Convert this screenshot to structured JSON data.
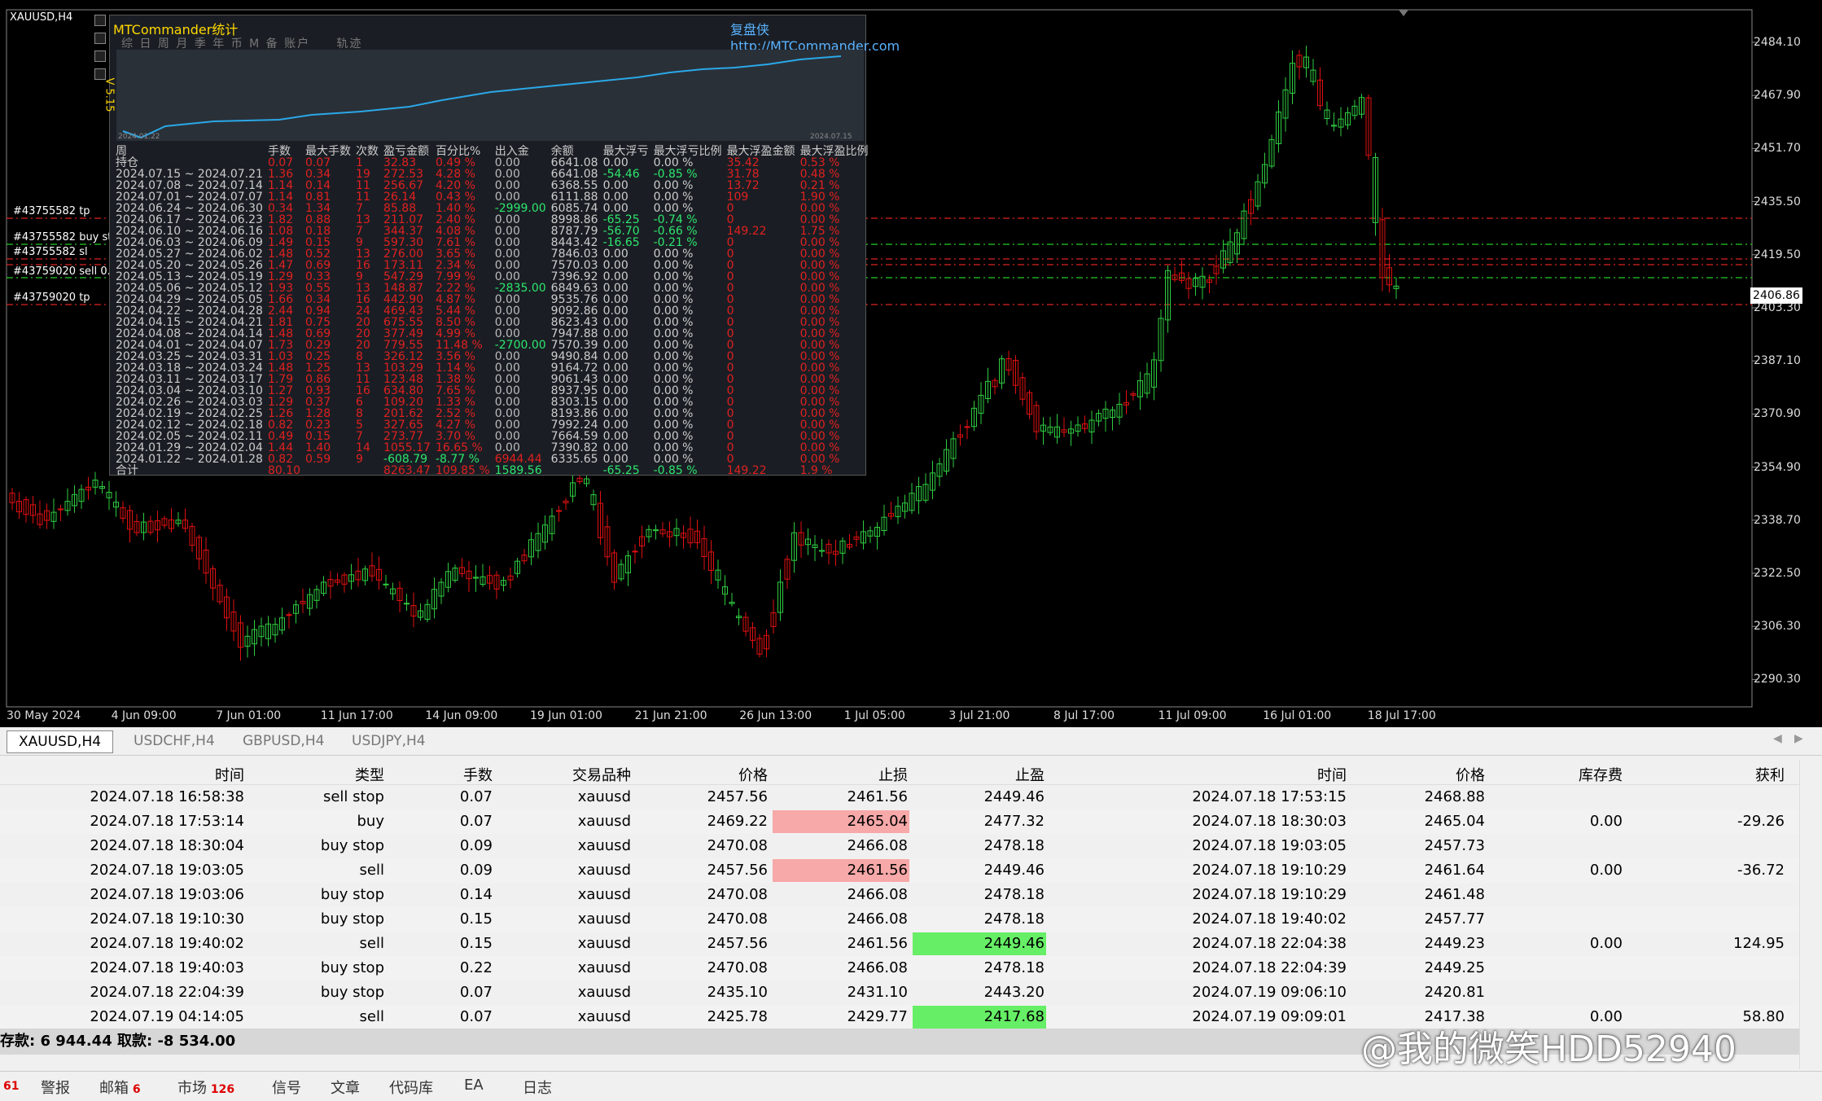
{
  "chart": {
    "symbol_title": "XAUUSD,H4",
    "current_price": "2406.86",
    "price_labels": [
      "2484.10",
      "2467.90",
      "2451.70",
      "2435.50",
      "2419.50",
      "2403.30",
      "2387.10",
      "2370.90",
      "2354.90",
      "2338.70",
      "2322.50",
      "2306.30",
      "2290.30"
    ],
    "time_labels": [
      "30 May 2024",
      "4 Jun 09:00",
      "7 Jun 01:00",
      "11 Jun 17:00",
      "14 Jun 09:00",
      "19 Jun 01:00",
      "21 Jun 21:00",
      "26 Jun 13:00",
      "1 Jul 05:00",
      "3 Jul 21:00",
      "8 Jul 17:00",
      "11 Jul 09:00",
      "16 Jul 01:00",
      "18 Jul 17:00"
    ],
    "order_labels": [
      "#43755582 tp",
      "#43755582 buy st",
      "#43755582 sl",
      "#43759020 sell 0.0",
      "#43759020 tp"
    ]
  },
  "stats": {
    "title": "MTCommander统计",
    "url": "复盘侠 http://MTCommander.com",
    "tabs": "综 日 周 月 季 年 币 M 备 账户",
    "tab_extra": "轨迹",
    "version": "V 5.15",
    "mini_start": "2024.01.22",
    "mini_end": "2024.07.15",
    "headers": [
      "周",
      "手数",
      "最大手数",
      "次数",
      "盈亏金额",
      "百分比%",
      "出入金",
      "余额",
      "最大浮亏",
      "最大浮亏比例",
      "最大浮盈金额",
      "最大浮盈比例"
    ],
    "holding": [
      "持仓",
      "0.07",
      "0.07",
      "1",
      "32.83",
      "0.49 %",
      "0.00",
      "6641.08",
      "0.00",
      "0.00 %",
      "35.42",
      "0.53 %"
    ],
    "rows": [
      [
        "2024.07.15 ~ 2024.07.21",
        "1.36",
        "0.34",
        "19",
        "272.53",
        "4.28 %",
        "0.00",
        "6641.08",
        "-54.46",
        "-0.85 %",
        "31.78",
        "0.48 %"
      ],
      [
        "2024.07.08 ~ 2024.07.14",
        "1.14",
        "0.14",
        "11",
        "256.67",
        "4.20 %",
        "0.00",
        "6368.55",
        "0.00",
        "0.00 %",
        "13.72",
        "0.21 %"
      ],
      [
        "2024.07.01 ~ 2024.07.07",
        "1.14",
        "0.81",
        "11",
        "26.14",
        "0.43 %",
        "0.00",
        "6111.88",
        "0.00",
        "0.00 %",
        "109",
        "1.90 %"
      ],
      [
        "2024.06.24 ~ 2024.06.30",
        "0.34",
        "1.34",
        "7",
        "85.88",
        "1.40 %",
        "-2999.00",
        "6085.74",
        "0.00",
        "0.00 %",
        "0",
        "0.00 %"
      ],
      [
        "2024.06.17 ~ 2024.06.23",
        "1.82",
        "0.88",
        "13",
        "211.07",
        "2.40 %",
        "0.00",
        "8998.86",
        "-65.25",
        "-0.74 %",
        "0",
        "0.00 %"
      ],
      [
        "2024.06.10 ~ 2024.06.16",
        "1.08",
        "0.18",
        "7",
        "344.37",
        "4.08 %",
        "0.00",
        "8787.79",
        "-56.70",
        "-0.66 %",
        "149.22",
        "1.75 %"
      ],
      [
        "2024.06.03 ~ 2024.06.09",
        "1.49",
        "0.15",
        "9",
        "597.30",
        "7.61 %",
        "0.00",
        "8443.42",
        "-16.65",
        "-0.21 %",
        "0",
        "0.00 %"
      ],
      [
        "2024.05.27 ~ 2024.06.02",
        "1.48",
        "0.52",
        "13",
        "276.00",
        "3.65 %",
        "0.00",
        "7846.03",
        "0.00",
        "0.00 %",
        "0",
        "0.00 %"
      ],
      [
        "2024.05.20 ~ 2024.05.26",
        "1.47",
        "0.69",
        "16",
        "173.11",
        "2.34 %",
        "0.00",
        "7570.03",
        "0.00",
        "0.00 %",
        "0",
        "0.00 %"
      ],
      [
        "2024.05.13 ~ 2024.05.19",
        "1.29",
        "0.33",
        "9",
        "547.29",
        "7.99 %",
        "0.00",
        "7396.92",
        "0.00",
        "0.00 %",
        "0",
        "0.00 %"
      ],
      [
        "2024.05.06 ~ 2024.05.12",
        "1.93",
        "0.55",
        "13",
        "148.87",
        "2.22 %",
        "-2835.00",
        "6849.63",
        "0.00",
        "0.00 %",
        "0",
        "0.00 %"
      ],
      [
        "2024.04.29 ~ 2024.05.05",
        "1.66",
        "0.34",
        "16",
        "442.90",
        "4.87 %",
        "0.00",
        "9535.76",
        "0.00",
        "0.00 %",
        "0",
        "0.00 %"
      ],
      [
        "2024.04.22 ~ 2024.04.28",
        "2.44",
        "0.94",
        "24",
        "469.43",
        "5.44 %",
        "0.00",
        "9092.86",
        "0.00",
        "0.00 %",
        "0",
        "0.00 %"
      ],
      [
        "2024.04.15 ~ 2024.04.21",
        "1.81",
        "0.75",
        "20",
        "675.55",
        "8.50 %",
        "0.00",
        "8623.43",
        "0.00",
        "0.00 %",
        "0",
        "0.00 %"
      ],
      [
        "2024.04.08 ~ 2024.04.14",
        "1.48",
        "0.69",
        "20",
        "377.49",
        "4.99 %",
        "0.00",
        "7947.88",
        "0.00",
        "0.00 %",
        "0",
        "0.00 %"
      ],
      [
        "2024.04.01 ~ 2024.04.07",
        "1.73",
        "0.29",
        "20",
        "779.55",
        "11.48 %",
        "-2700.00",
        "7570.39",
        "0.00",
        "0.00 %",
        "0",
        "0.00 %"
      ],
      [
        "2024.03.25 ~ 2024.03.31",
        "1.03",
        "0.25",
        "8",
        "326.12",
        "3.56 %",
        "0.00",
        "9490.84",
        "0.00",
        "0.00 %",
        "0",
        "0.00 %"
      ],
      [
        "2024.03.18 ~ 2024.03.24",
        "1.48",
        "1.25",
        "13",
        "103.29",
        "1.14 %",
        "0.00",
        "9164.72",
        "0.00",
        "0.00 %",
        "0",
        "0.00 %"
      ],
      [
        "2024.03.11 ~ 2024.03.17",
        "1.79",
        "0.86",
        "11",
        "123.48",
        "1.38 %",
        "0.00",
        "9061.43",
        "0.00",
        "0.00 %",
        "0",
        "0.00 %"
      ],
      [
        "2024.03.04 ~ 2024.03.10",
        "1.27",
        "0.93",
        "16",
        "634.80",
        "7.65 %",
        "0.00",
        "8937.95",
        "0.00",
        "0.00 %",
        "0",
        "0.00 %"
      ],
      [
        "2024.02.26 ~ 2024.03.03",
        "1.29",
        "0.37",
        "6",
        "109.20",
        "1.33 %",
        "0.00",
        "8303.15",
        "0.00",
        "0.00 %",
        "0",
        "0.00 %"
      ],
      [
        "2024.02.19 ~ 2024.02.25",
        "1.26",
        "1.28",
        "8",
        "201.62",
        "2.52 %",
        "0.00",
        "8193.86",
        "0.00",
        "0.00 %",
        "0",
        "0.00 %"
      ],
      [
        "2024.02.12 ~ 2024.02.18",
        "0.82",
        "0.23",
        "5",
        "327.65",
        "4.27 %",
        "0.00",
        "7992.24",
        "0.00",
        "0.00 %",
        "0",
        "0.00 %"
      ],
      [
        "2024.02.05 ~ 2024.02.11",
        "0.49",
        "0.15",
        "7",
        "273.77",
        "3.70 %",
        "0.00",
        "7664.59",
        "0.00",
        "0.00 %",
        "0",
        "0.00 %"
      ],
      [
        "2024.01.29 ~ 2024.02.04",
        "1.44",
        "1.40",
        "14",
        "1055.17",
        "16.65 %",
        "0.00",
        "7390.82",
        "0.00",
        "0.00 %",
        "0",
        "0.00 %"
      ],
      [
        "2024.01.22 ~ 2024.01.28",
        "0.82",
        "0.59",
        "9",
        "-608.79",
        "-8.77 %",
        "6944.44",
        "6335.65",
        "0.00",
        "0.00 %",
        "0",
        "0.00 %"
      ]
    ],
    "total": [
      "合计",
      "80.10",
      "",
      "",
      "8263.47",
      "109.85 %",
      "1589.56",
      "",
      "-65.25",
      "-0.85 %",
      "149.22",
      "1.9 %"
    ]
  },
  "chart_tabs": [
    "XAUUSD,H4",
    "USDCHF,H4",
    "GBPUSD,H4",
    "USDJPY,H4"
  ],
  "orders": {
    "headers": [
      "时间",
      "类型",
      "手数",
      "交易品种",
      "价格",
      "止损",
      "止盈",
      "时间",
      "价格",
      "库存费",
      "获利"
    ],
    "rows": [
      [
        "2024.07.18 16:58:38",
        "sell stop",
        "0.07",
        "xauusd",
        "2457.56",
        "2461.56",
        "2449.46",
        "2024.07.18 17:53:15",
        "2468.88",
        "",
        ""
      ],
      [
        "2024.07.18 17:53:14",
        "buy",
        "0.07",
        "xauusd",
        "2469.22",
        "2465.04",
        "2477.32",
        "2024.07.18 18:30:03",
        "2465.04",
        "0.00",
        "-29.26"
      ],
      [
        "2024.07.18 18:30:04",
        "buy stop",
        "0.09",
        "xauusd",
        "2470.08",
        "2466.08",
        "2478.18",
        "2024.07.18 19:03:05",
        "2457.73",
        "",
        ""
      ],
      [
        "2024.07.18 19:03:05",
        "sell",
        "0.09",
        "xauusd",
        "2457.56",
        "2461.56",
        "2449.46",
        "2024.07.18 19:10:29",
        "2461.64",
        "0.00",
        "-36.72"
      ],
      [
        "2024.07.18 19:03:06",
        "buy stop",
        "0.14",
        "xauusd",
        "2470.08",
        "2466.08",
        "2478.18",
        "2024.07.18 19:10:29",
        "2461.48",
        "",
        ""
      ],
      [
        "2024.07.18 19:10:30",
        "buy stop",
        "0.15",
        "xauusd",
        "2470.08",
        "2466.08",
        "2478.18",
        "2024.07.18 19:40:02",
        "2457.77",
        "",
        ""
      ],
      [
        "2024.07.18 19:40:02",
        "sell",
        "0.15",
        "xauusd",
        "2457.56",
        "2461.56",
        "2449.46",
        "2024.07.18 22:04:38",
        "2449.23",
        "0.00",
        "124.95"
      ],
      [
        "2024.07.18 19:40:03",
        "buy stop",
        "0.22",
        "xauusd",
        "2470.08",
        "2466.08",
        "2478.18",
        "2024.07.18 22:04:39",
        "2449.25",
        "",
        ""
      ],
      [
        "2024.07.18 22:04:39",
        "buy stop",
        "0.07",
        "xauusd",
        "2435.10",
        "2431.10",
        "2443.20",
        "2024.07.19 09:06:10",
        "2420.81",
        "",
        ""
      ],
      [
        "2024.07.19 04:14:05",
        "sell",
        "0.07",
        "xauusd",
        "2425.78",
        "2429.77",
        "2417.68",
        "2024.07.19 09:09:01",
        "2417.38",
        "0.00",
        "58.80"
      ]
    ],
    "highlights": {
      "sl_hit_color": "#f7a8a8",
      "tp_hit_color": "#66ee66"
    },
    "balance_text": "存款: 6 944.44  取款: -8 534.00"
  },
  "bottom_tabs": [
    {
      "label": "61",
      "badge": ""
    },
    {
      "label": "警报",
      "badge": ""
    },
    {
      "label": "邮箱",
      "badge": "6"
    },
    {
      "label": "市场",
      "badge": "126"
    },
    {
      "label": "信号",
      "badge": ""
    },
    {
      "label": "文章",
      "badge": ""
    },
    {
      "label": "代码库",
      "badge": ""
    },
    {
      "label": "EA",
      "badge": ""
    },
    {
      "label": "日志",
      "badge": ""
    }
  ],
  "watermark": "@我的微笑HDD52940"
}
